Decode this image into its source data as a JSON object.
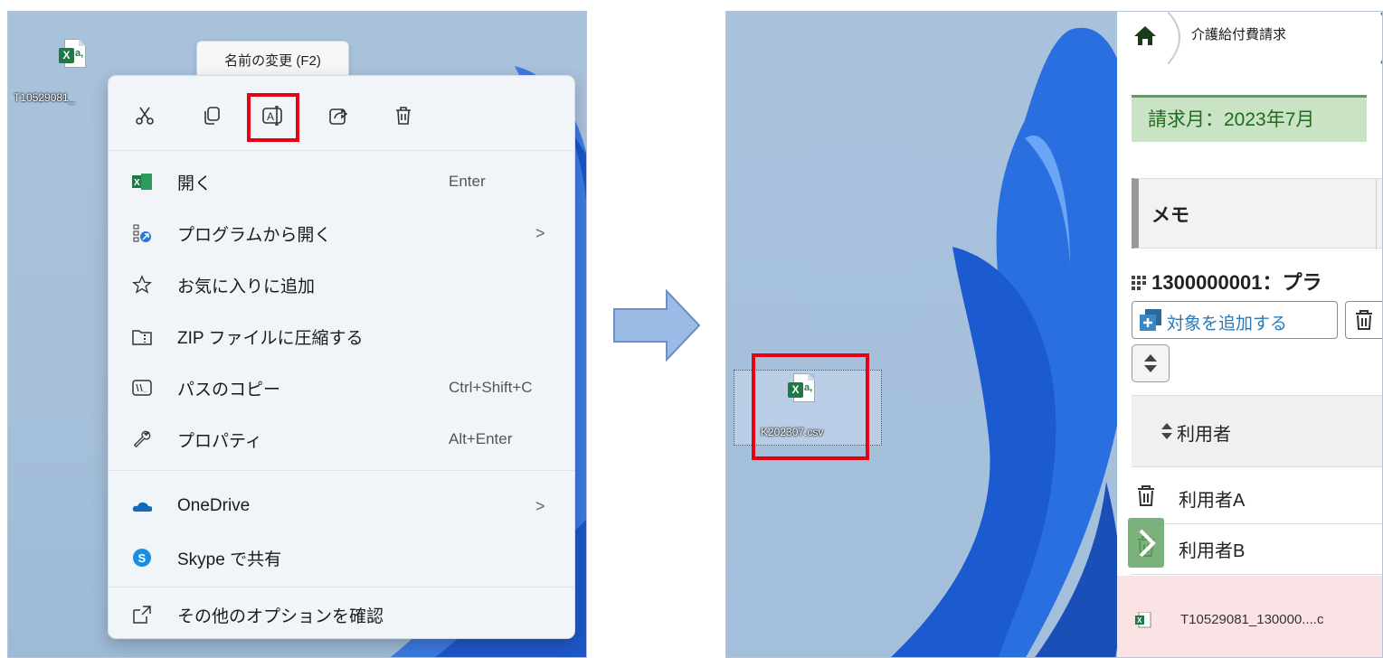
{
  "left_panel": {
    "desktop_file": {
      "label": "T10529081_"
    },
    "tooltip": "名前の変更 (F2)",
    "context_menu": {
      "toolbar": [
        {
          "name": "cut",
          "icon": "scissors-icon"
        },
        {
          "name": "copy",
          "icon": "copy-icon"
        },
        {
          "name": "rename",
          "icon": "rename-icon"
        },
        {
          "name": "share",
          "icon": "share-icon"
        },
        {
          "name": "delete",
          "icon": "trash-icon"
        }
      ],
      "items": [
        {
          "label": "開く",
          "shortcut": "Enter",
          "icon": "excel-icon"
        },
        {
          "label": "プログラムから開く",
          "submenu": ">",
          "icon": "open-with-icon"
        },
        {
          "label": "お気に入りに追加",
          "icon": "star-icon"
        },
        {
          "label": "ZIP ファイルに圧縮する",
          "icon": "zip-folder-icon"
        },
        {
          "label": "パスのコピー",
          "shortcut": "Ctrl+Shift+C",
          "icon": "copy-path-icon"
        },
        {
          "label": "プロパティ",
          "shortcut": "Alt+Enter",
          "icon": "wrench-icon"
        },
        {
          "label": "OneDrive",
          "submenu": ">",
          "icon": "onedrive-icon"
        },
        {
          "label": "Skype で共有",
          "icon": "skype-icon"
        },
        {
          "label": "その他のオプションを確認",
          "icon": "more-options-icon"
        }
      ]
    }
  },
  "right_panel": {
    "desktop_file": {
      "label": "K202307.csv"
    },
    "app": {
      "breadcrumb": "介護給付費請求",
      "billing_month": "請求月：2023年7月",
      "memo_label": "メモ",
      "office": "1300000001：プラ",
      "add_target_button": "対象を追加する",
      "table_header": "利用者",
      "rows": [
        "利用者A",
        "利用者B"
      ],
      "download_filename": "T10529081_130000....c"
    }
  },
  "colors": {
    "highlight": "#e60012",
    "excel_green": "#1d7a45",
    "tab_green": "#cbe3c5",
    "arrow_blue": "#9bbbe7"
  }
}
